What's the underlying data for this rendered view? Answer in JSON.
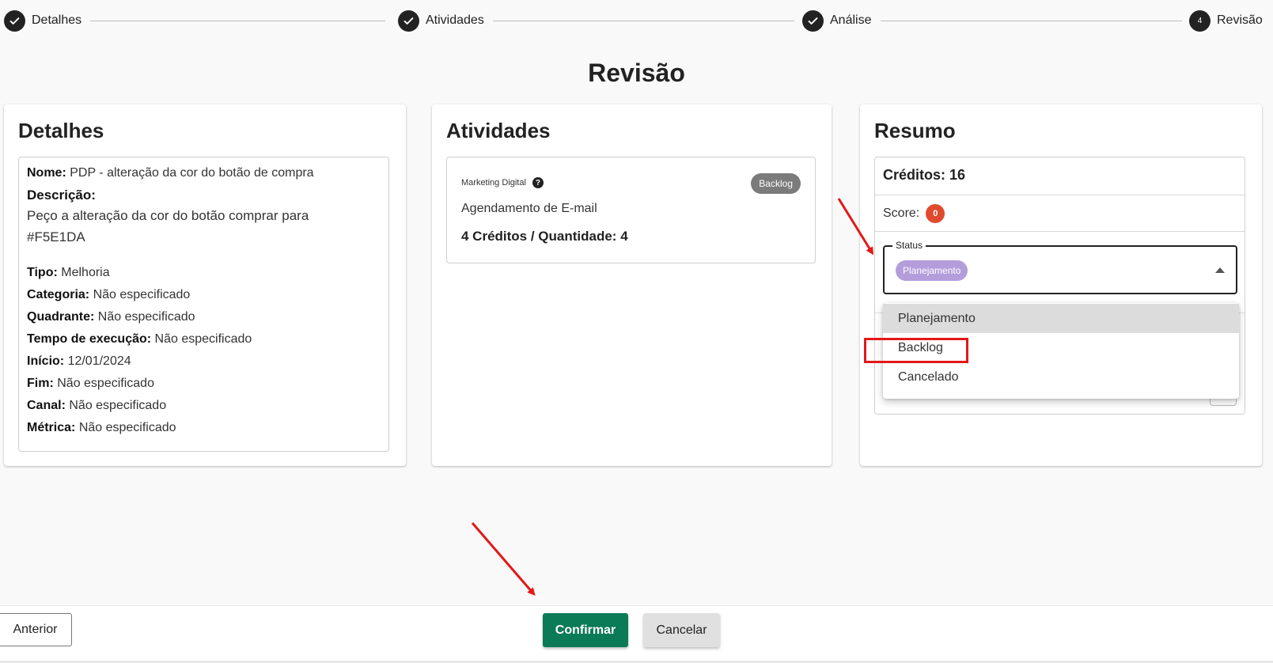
{
  "stepper": {
    "steps": [
      {
        "label": "Detalhes",
        "state": "done"
      },
      {
        "label": "Atividades",
        "state": "done"
      },
      {
        "label": "Análise",
        "state": "done"
      },
      {
        "label": "Revisão",
        "state": "active",
        "number": "4"
      }
    ]
  },
  "page": {
    "title": "Revisão"
  },
  "detalhes": {
    "title": "Detalhes",
    "nome_label": "Nome:",
    "nome_value": "PDP - alteração da cor do botão de compra",
    "descricao_label": "Descrição:",
    "descricao_value": "Peço a alteração da cor do botão comprar para #F5E1DA",
    "fields": [
      {
        "label": "Tipo:",
        "value": "Melhoria"
      },
      {
        "label": "Categoria:",
        "value": "Não especificado"
      },
      {
        "label": "Quadrante:",
        "value": "Não especificado"
      },
      {
        "label": "Tempo de execução:",
        "value": "Não especificado"
      },
      {
        "label": "Início:",
        "value": "12/01/2024"
      },
      {
        "label": "Fim:",
        "value": "Não especificado"
      },
      {
        "label": "Canal:",
        "value": "Não especificado"
      },
      {
        "label": "Métrica:",
        "value": "Não especificado"
      }
    ]
  },
  "atividades": {
    "title": "Atividades",
    "item": {
      "category": "Marketing Digital",
      "status_chip": "Backlog",
      "name": "Agendamento de E-mail",
      "credits": "4 Créditos / Quantidade: 4"
    }
  },
  "resumo": {
    "title": "Resumo",
    "creditos": "Créditos: 16",
    "score_label": "Score:",
    "score_value": "0",
    "status_legend": "Status",
    "status_selected": "Planejamento"
  },
  "dropdown": {
    "options": [
      "Planejamento",
      "Backlog",
      "Cancelado"
    ],
    "highlighted_index": 0
  },
  "footer": {
    "anterior": "Anterior",
    "confirmar": "Confirmar",
    "cancelar": "Cancelar"
  },
  "colors": {
    "confirm_green": "#0b7a56",
    "score_red": "#e04b2d",
    "chip_planejamento": "#b39ddb",
    "chip_backlog": "#7b7b7b",
    "annotation_red": "#e31818"
  }
}
